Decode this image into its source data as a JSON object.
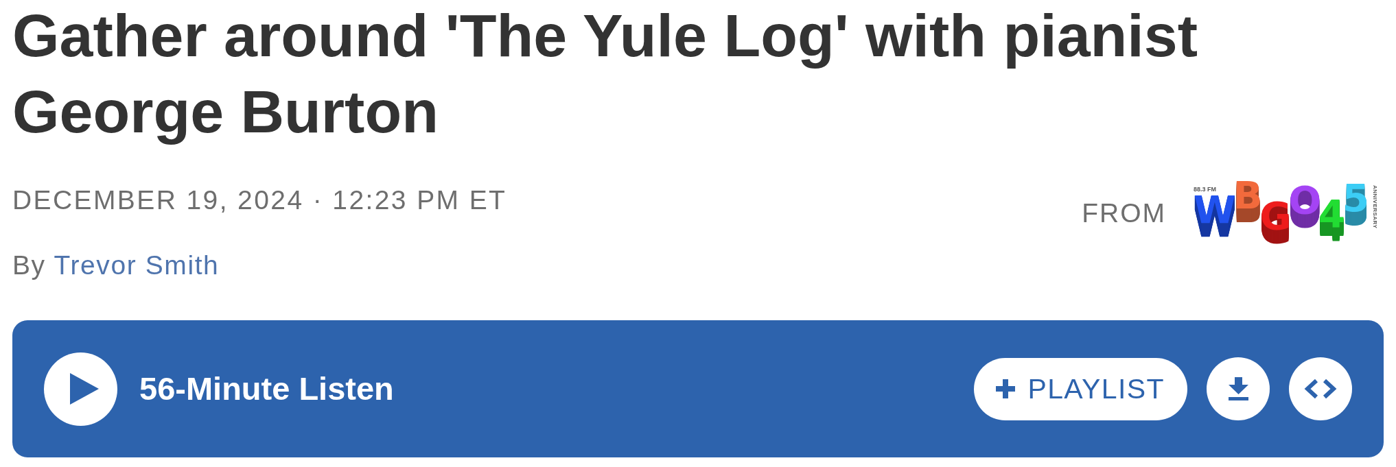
{
  "article": {
    "title": "Gather around 'The Yule Log' with pianist George Burton",
    "dateline": "DECEMBER 19, 2024 · 12:23 PM ET",
    "byline": {
      "prefix": "By",
      "author": "Trevor Smith"
    }
  },
  "source": {
    "label": "FROM",
    "logo": {
      "frequency": "88.3 FM",
      "letters": [
        {
          "text": "W",
          "color": "#2152ee"
        },
        {
          "text": "B",
          "color": "#f26a3c"
        },
        {
          "text": "G",
          "color": "#ee1c1c"
        },
        {
          "text": "O",
          "color": "#a444f4"
        },
        {
          "text": "4",
          "color": "#22dd33"
        },
        {
          "text": "5",
          "color": "#3ccdf5"
        }
      ],
      "tagline": "ANNIVERSARY"
    }
  },
  "player": {
    "duration_label": "56-Minute Listen",
    "playlist_button": "PLAYLIST"
  }
}
